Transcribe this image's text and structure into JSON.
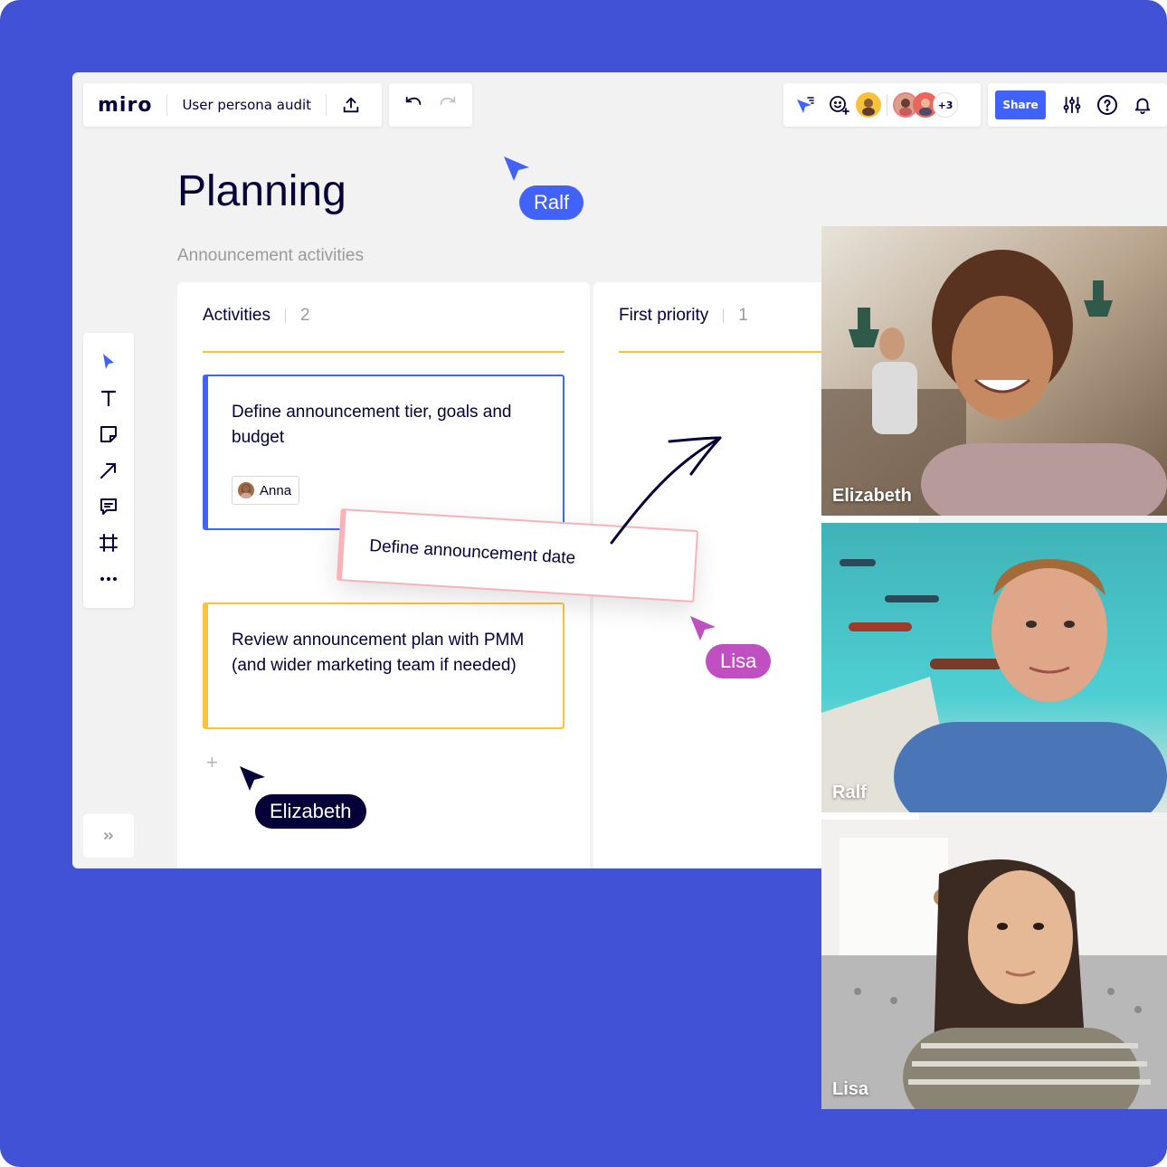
{
  "app": {
    "logo": "miro",
    "board_name": "User persona audit"
  },
  "collab": {
    "extra_count": "+3"
  },
  "toolbar": {
    "share_label": "Share"
  },
  "board": {
    "title": "Planning",
    "subtitle": "Announcement activities",
    "columns": [
      {
        "title": "Activities",
        "count": "2"
      },
      {
        "title": "First priority",
        "count": "1"
      }
    ],
    "cards": [
      {
        "text": "Define announcement tier, goals and budget",
        "assignee": "Anna",
        "color": "#4262ff"
      },
      {
        "text": "Review announcement plan with PMM (and wider marketing team if needed)",
        "color": "#fdc23a"
      }
    ],
    "dragging_card": {
      "text": "Define announcement date",
      "color": "#f7b3b8"
    }
  },
  "cursors": [
    {
      "name": "Ralf",
      "color": "#4262ff"
    },
    {
      "name": "Lisa",
      "color": "#c04fc1"
    },
    {
      "name": "Elizabeth",
      "color": "#050038"
    }
  ],
  "videos": [
    {
      "name": "Elizabeth"
    },
    {
      "name": "Ralf"
    },
    {
      "name": "Lisa"
    }
  ],
  "icons": {
    "left_tools": [
      "select-icon",
      "text-icon",
      "sticky-note-icon",
      "arrow-icon",
      "comment-icon",
      "frame-icon",
      "more-icon"
    ],
    "top_right": [
      "cursor-filter-icon",
      "reaction-icon",
      "settings-sliders-icon",
      "help-icon",
      "bell-icon"
    ],
    "expand": "expand-icon"
  },
  "colors": {
    "background": "#4152d6",
    "accent": "#4262ff",
    "canvas": "#f2f2f2"
  }
}
